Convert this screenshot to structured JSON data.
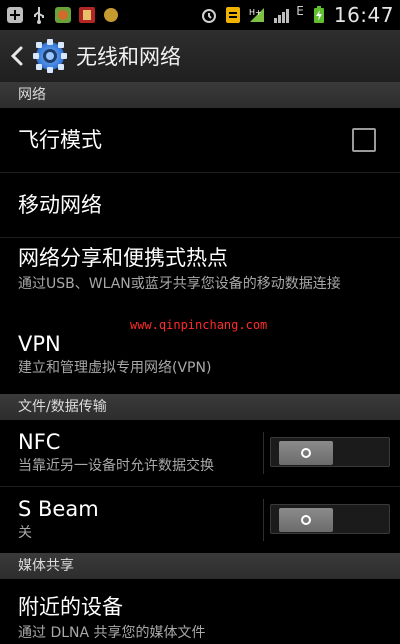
{
  "status_bar": {
    "time": "16:47",
    "network_label": "E",
    "icons": [
      "plus-box-icon",
      "usb-icon",
      "app-icon-1",
      "app-icon-2",
      "circle-icon",
      "alarm-icon",
      "document-icon",
      "wifi-signal-icon",
      "signal-icon",
      "battery-icon"
    ]
  },
  "header": {
    "title": "无线和网络"
  },
  "sections": {
    "network": "网络",
    "file_transfer": "文件/数据传输",
    "media_share": "媒体共享"
  },
  "items": {
    "airplane": {
      "title": "飞行模式",
      "checked": false
    },
    "mobile": {
      "title": "移动网络"
    },
    "tethering": {
      "title": "网络分享和便携式热点",
      "subtitle": "通过USB、WLAN或蓝牙共享您设备的移动数据连接"
    },
    "vpn": {
      "title": "VPN",
      "subtitle": "建立和管理虚拟专用网络(VPN)"
    },
    "nfc": {
      "title": "NFC",
      "subtitle": "当靠近另一设备时允许数据交换",
      "toggle": "off"
    },
    "sbeam": {
      "title": "S Beam",
      "subtitle": "关",
      "toggle": "off"
    },
    "nearby": {
      "title": "附近的设备",
      "subtitle": "通过 DLNA 共享您的媒体文件"
    }
  },
  "watermark": "www.qinpinchang.com",
  "colors": {
    "background": "#000000",
    "section_header": "#333333",
    "subtitle": "#a8a8a8",
    "watermark": "#ff2a2a"
  }
}
